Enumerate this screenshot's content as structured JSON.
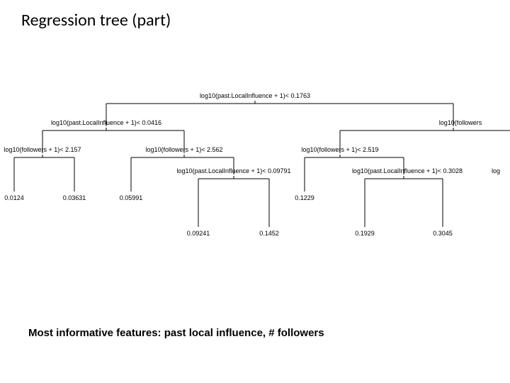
{
  "title": "Regression tree (part)",
  "caption": "Most informative features: past local influence, # followers",
  "tree": {
    "root": "log10(past.LocalInfluence + 1)< 0.1763",
    "L": {
      "cond": "log10(past.LocalInfluence + 1)< 0.0416",
      "L": {
        "cond": "log10(followers + 1)< 2.157",
        "leafL": "0.0124",
        "leafR": "0.03631"
      },
      "R": {
        "cond": "log10(followers + 1)< 2.562",
        "leafL": "0.05991",
        "sub": {
          "cond": "log10(past.LocalInfluence + 1)< 0.09791",
          "leafL": "0.09241",
          "leafR": "0.1452"
        }
      }
    },
    "R": {
      "condTrunc": "log10(followers",
      "L": {
        "cond": "log10(followers + 1)< 2.519",
        "leafL": "0.1229",
        "sub": {
          "cond": "log10(past.LocalInfluence + 1)< 0.3028",
          "leafL": "0.1929",
          "leafR": "0.3045",
          "tailTrunc": "log"
        }
      }
    }
  }
}
